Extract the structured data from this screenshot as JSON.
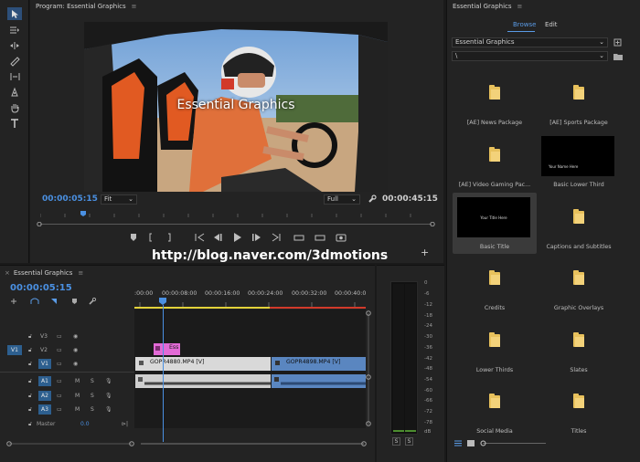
{
  "program": {
    "title": "Program: Essential Graphics",
    "overlay_text": "Essential Graphics",
    "timecode_current": "00:00:05:15",
    "timecode_duration": "00:00:45:15",
    "zoom_select": "Fit",
    "quality_select": "Full"
  },
  "watermark": "http://blog.naver.com/3dmotions",
  "essential_graphics": {
    "title": "Essential Graphics",
    "tabs": [
      {
        "label": "Browse",
        "active": true
      },
      {
        "label": "Edit",
        "active": false
      }
    ],
    "library_select": "Essential Graphics",
    "path_select": "\\",
    "items": [
      {
        "label": "[AE] News Package",
        "thumb": "folder"
      },
      {
        "label": "[AE] Sports Package",
        "thumb": "folder"
      },
      {
        "label": "[AE] Video Gaming Pac...",
        "thumb": "folder"
      },
      {
        "label": "Basic Lower Third",
        "thumb": "lower-third",
        "thumb_text": "Your Name Here"
      },
      {
        "label": "Basic Title",
        "thumb": "title",
        "thumb_text": "Your Title Here",
        "selected": true
      },
      {
        "label": "Captions and Subtitles",
        "thumb": "folder"
      },
      {
        "label": "Credits",
        "thumb": "folder"
      },
      {
        "label": "Graphic Overlays",
        "thumb": "folder"
      },
      {
        "label": "Lower Thirds",
        "thumb": "folder"
      },
      {
        "label": "Slates",
        "thumb": "folder"
      },
      {
        "label": "Social Media",
        "thumb": "folder"
      },
      {
        "label": "Titles",
        "thumb": "folder"
      }
    ]
  },
  "timeline": {
    "title": "Essential Graphics",
    "timecode": "00:00:05:15",
    "ruler": [
      ":00:00",
      "00:00:08:00",
      "00:00:16:00",
      "00:00:24:00",
      "00:00:32:00",
      "00:00:40:0"
    ],
    "video_tracks": [
      {
        "name": "V3",
        "source": ""
      },
      {
        "name": "V2",
        "source": "V1"
      },
      {
        "name": "V1",
        "source": ""
      }
    ],
    "audio_tracks": [
      {
        "name": "A1",
        "m": "M",
        "s": "S"
      },
      {
        "name": "A2",
        "m": "M",
        "s": "S"
      },
      {
        "name": "A3",
        "m": "M",
        "s": "S"
      }
    ],
    "master_label": "Master",
    "master_value": "0.0",
    "graphic_clip_label": "Ess",
    "clips": [
      {
        "label": "GOPR4880.MP4 [V]"
      },
      {
        "label": "GOPR4898.MP4 [V]"
      }
    ]
  },
  "meters": {
    "scale": [
      "0",
      "-6",
      "-12",
      "-18",
      "-24",
      "-30",
      "-36",
      "-42",
      "-48",
      "-54",
      "-60",
      "-66",
      "-72",
      "-78",
      "dB"
    ],
    "solo_left": "S",
    "solo_right": "S"
  },
  "colors": {
    "accent_blue": "#4a90e2",
    "graphic_clip": "#e26ad6",
    "video_clip": "#d9d9d9",
    "audio_clip": "#5a86c0"
  }
}
